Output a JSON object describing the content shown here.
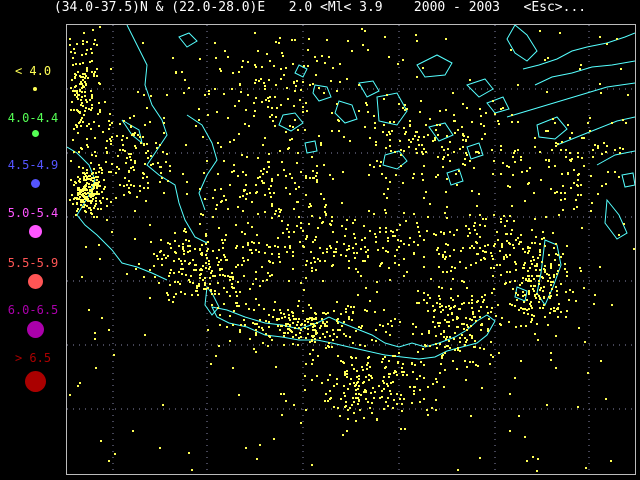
{
  "title": "(34.0-37.5)N & (22.0-28.0)E   2.0 <Ml< 3.9    2000 - 2003   <Esc>...",
  "colors": {
    "background": "#000000",
    "coastline": "#55ffff",
    "events": "#ffff55",
    "grid": "#8888aa"
  },
  "legend": [
    {
      "label": "< 4.0",
      "color": "#ffff55",
      "dot_size": 3
    },
    {
      "label": "4.0-4.4",
      "color": "#55ff55",
      "dot_size": 6
    },
    {
      "label": "4.5-4.9",
      "color": "#5555ff",
      "dot_size": 9
    },
    {
      "label": "5.0-5.4",
      "color": "#ff55ff",
      "dot_size": 12
    },
    {
      "label": "5.5-5.9",
      "color": "#ff5555",
      "dot_size": 14
    },
    {
      "label": "6.0-6.5",
      "color": "#aa00aa",
      "dot_size": 16
    },
    {
      "label": "> 6.5",
      "color": "#aa0000",
      "dot_size": 20
    }
  ],
  "map": {
    "lat_range": [
      34.0,
      37.5
    ],
    "lon_range": [
      22.0,
      28.0
    ],
    "grid": true
  }
}
